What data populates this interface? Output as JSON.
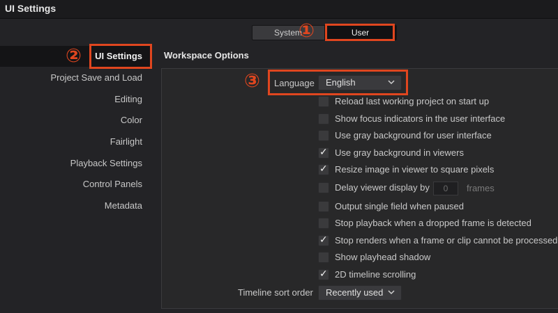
{
  "window": {
    "title": "UI Settings"
  },
  "tabs": {
    "system": "System",
    "user": "User"
  },
  "sidebar": {
    "items": [
      {
        "label": "UI Settings"
      },
      {
        "label": "Project Save and Load"
      },
      {
        "label": "Editing"
      },
      {
        "label": "Color"
      },
      {
        "label": "Fairlight"
      },
      {
        "label": "Playback Settings"
      },
      {
        "label": "Control Panels"
      },
      {
        "label": "Metadata"
      }
    ],
    "selected": "UI Settings"
  },
  "workspace": {
    "title": "Workspace Options",
    "language": {
      "label": "Language",
      "value": "English"
    },
    "options": [
      {
        "label": "Reload last working project on start up",
        "checked": false
      },
      {
        "label": "Show focus indicators in the user interface",
        "checked": false
      },
      {
        "label": "Use gray background for user interface",
        "checked": false
      },
      {
        "label": "Use gray background in viewers",
        "checked": true
      },
      {
        "label": "Resize image in viewer to square pixels",
        "checked": true
      },
      {
        "label": "Delay viewer display by",
        "checked": false,
        "value": "0",
        "unit": "frames"
      },
      {
        "label": "Output single field when paused",
        "checked": false
      },
      {
        "label": "Stop playback when a dropped frame is detected",
        "checked": false
      },
      {
        "label": "Stop renders when a frame or clip cannot be processed",
        "checked": true
      },
      {
        "label": "Show playhead shadow",
        "checked": false
      },
      {
        "label": "2D timeline scrolling",
        "checked": true
      }
    ],
    "sort_order": {
      "label": "Timeline sort order",
      "value": "Recently used"
    }
  },
  "callouts": [
    "①",
    "②",
    "③"
  ],
  "icons": {
    "chevron": "chevron-down-icon",
    "check": "checkmark-icon"
  },
  "colors": {
    "highlight": "#e0461f",
    "background": "#232326",
    "panel": "#282829"
  }
}
